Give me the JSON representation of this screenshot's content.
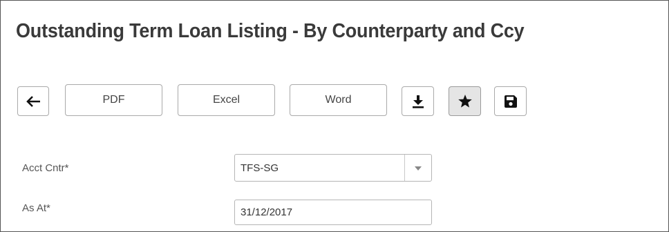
{
  "page": {
    "title": "Outstanding Term Loan Listing - By Counterparty and Ccy"
  },
  "toolbar": {
    "back_icon": "arrow-left-icon",
    "pdf_label": "PDF",
    "excel_label": "Excel",
    "word_label": "Word",
    "download_icon": "download-icon",
    "favorite_icon": "star-icon",
    "save_icon": "save-icon"
  },
  "form": {
    "acct_cntr": {
      "label": "Acct Cntr*",
      "value": "TFS-SG",
      "arrow_icon": "caret-down-icon"
    },
    "as_at": {
      "label": "As At*",
      "value": "31/12/2017"
    }
  },
  "colors": {
    "title": "#3a3a3a",
    "border": "#a9a9a9",
    "favorite_active_bg": "#e5e5e5"
  }
}
